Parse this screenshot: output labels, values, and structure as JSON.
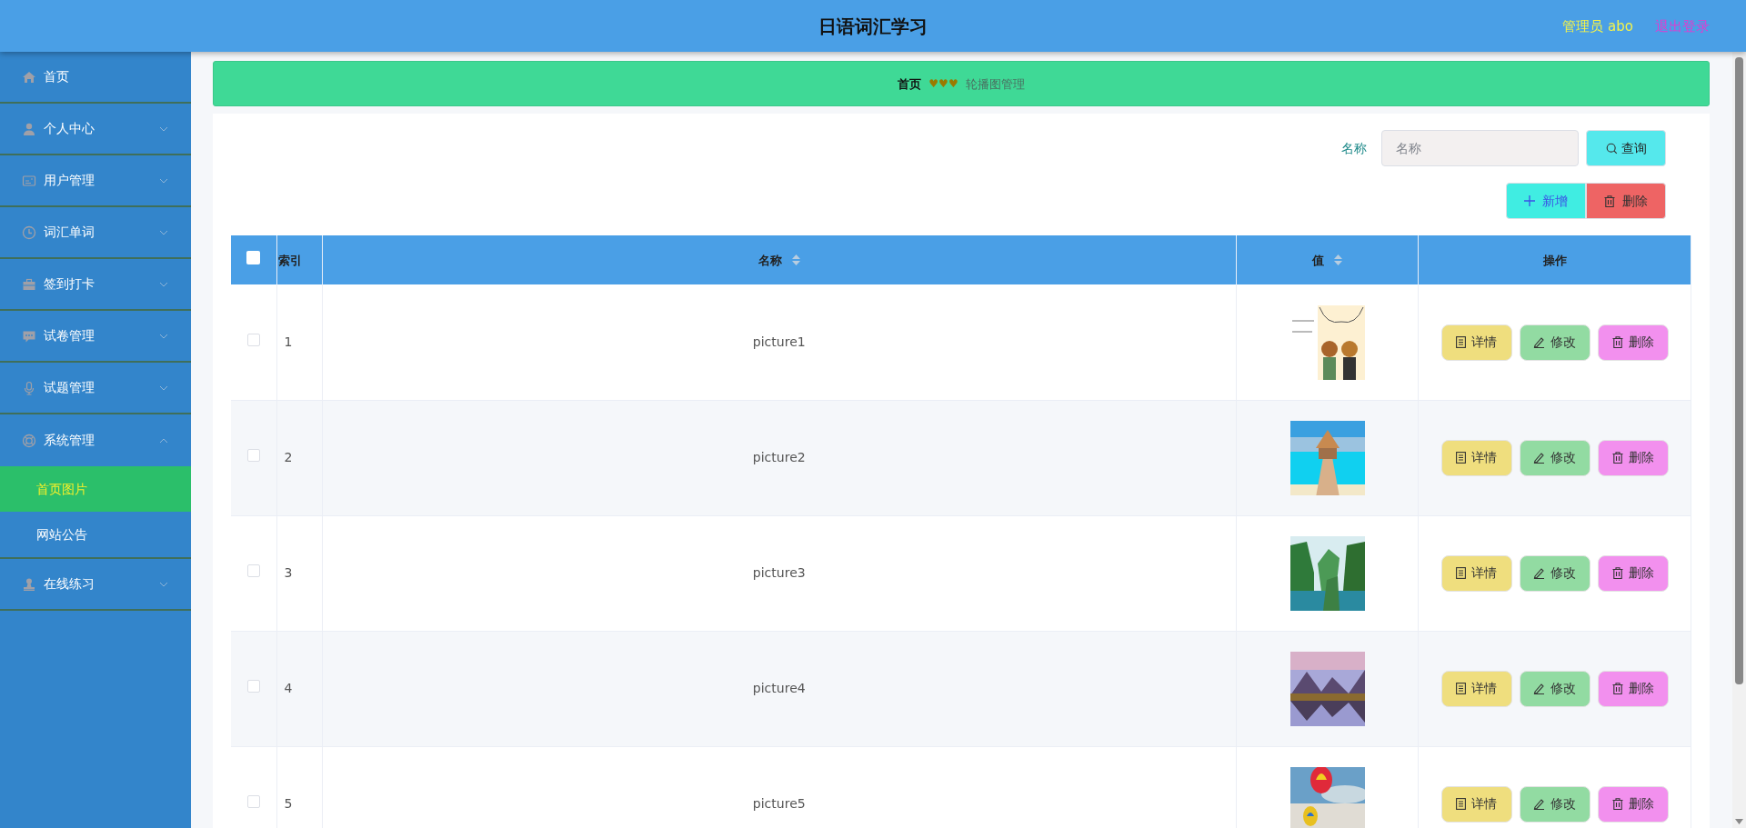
{
  "header": {
    "title": "日语词汇学习",
    "user": "管理员 abo",
    "logout": "退出登录"
  },
  "sidebar": {
    "items": [
      {
        "label": "首页",
        "expandable": false
      },
      {
        "label": "个人中心",
        "expandable": true,
        "expanded": false
      },
      {
        "label": "用户管理",
        "expandable": true,
        "expanded": false
      },
      {
        "label": "词汇单词",
        "expandable": true,
        "expanded": false
      },
      {
        "label": "签到打卡",
        "expandable": true,
        "expanded": false
      },
      {
        "label": "试卷管理",
        "expandable": true,
        "expanded": false
      },
      {
        "label": "试题管理",
        "expandable": true,
        "expanded": false
      },
      {
        "label": "系统管理",
        "expandable": true,
        "expanded": true,
        "children": [
          {
            "label": "首页图片",
            "selected": true
          },
          {
            "label": "网站公告",
            "selected": false
          }
        ]
      },
      {
        "label": "在线练习",
        "expandable": true,
        "expanded": false
      }
    ]
  },
  "breadcrumb": {
    "home": "首页",
    "separator": "♥♥♥",
    "current": "轮播图管理"
  },
  "search": {
    "label": "名称",
    "placeholder": "名称",
    "button": "查询"
  },
  "toolbar": {
    "add": "新增",
    "delete": "删除"
  },
  "table": {
    "select_all": {
      "checked": false
    },
    "columns": [
      {
        "label": "索引",
        "sortable": false
      },
      {
        "label": "名称",
        "sortable": true
      },
      {
        "label": "值",
        "sortable": true
      },
      {
        "label": "操作",
        "sortable": false
      }
    ],
    "rows": [
      {
        "checked": false,
        "index": "1",
        "name": "picture1",
        "value": {
          "kind": "picture"
        },
        "actions": [
          "详情",
          "修改",
          "删除"
        ]
      },
      {
        "checked": false,
        "index": "2",
        "name": "picture2",
        "value": {
          "kind": "picture"
        },
        "actions": [
          "详情",
          "修改",
          "删除"
        ]
      },
      {
        "checked": false,
        "index": "3",
        "name": "picture3",
        "value": {
          "kind": "picture"
        },
        "actions": [
          "详情",
          "修改",
          "删除"
        ]
      },
      {
        "checked": false,
        "index": "4",
        "name": "picture4",
        "value": {
          "kind": "picture"
        },
        "actions": [
          "详情",
          "修改",
          "删除"
        ]
      },
      {
        "checked": false,
        "index": "5",
        "name": "picture5",
        "value": {
          "kind": "picture"
        },
        "actions": [
          "详情",
          "修改",
          "删除"
        ]
      }
    ]
  }
}
